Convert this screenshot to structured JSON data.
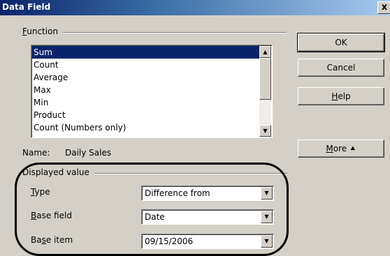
{
  "dialog": {
    "title": "Data Field",
    "close_glyph": "x"
  },
  "function_group": {
    "label_prefix": "",
    "label_underlined": "F",
    "label_rest": "unction",
    "items": [
      "Sum",
      "Count",
      "Average",
      "Max",
      "Min",
      "Product",
      "Count (Numbers only)"
    ],
    "selected_index": 0
  },
  "name_row": {
    "label": "Name:",
    "value": "Daily Sales"
  },
  "buttons": {
    "ok": "OK",
    "cancel": "Cancel",
    "help_underlined": "H",
    "help_rest": "elp",
    "more_underlined": "M",
    "more_rest": "ore",
    "more_arrow": "⯅"
  },
  "displayed_value": {
    "label": "Displayed value",
    "type_label_u": "T",
    "type_label_rest": "ype",
    "type_value": "Difference from",
    "base_field_label_u": "B",
    "base_field_label_rest": "ase field",
    "base_field_value": "Date",
    "base_item_label_pre": "Ba",
    "base_item_label_u": "s",
    "base_item_label_rest": "e item",
    "base_item_value": "09/15/2006"
  },
  "icons": {
    "scroll_up": "up-arrow-icon",
    "scroll_down": "down-arrow-icon",
    "dropdown": "chevron-down-icon"
  }
}
